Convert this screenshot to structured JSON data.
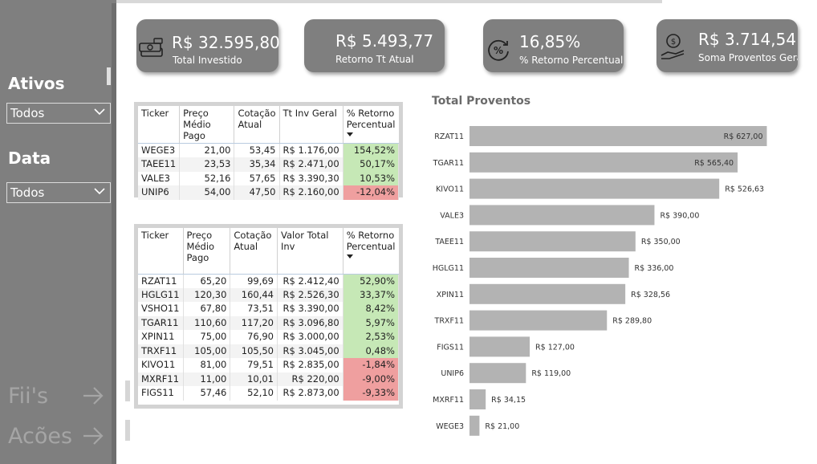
{
  "sidebar": {
    "filters": [
      {
        "label": "Ativos",
        "value": "Todos"
      },
      {
        "label": "Data",
        "value": "Todos"
      }
    ],
    "nav": [
      {
        "label": "Fii's"
      },
      {
        "label": "Acões"
      }
    ]
  },
  "kpis": [
    {
      "value": "R$ 32.595,80",
      "label": "Total Investido",
      "icon": "money-stack-icon"
    },
    {
      "value": "R$ 5.493,77",
      "label": "Retorno Tt Atual",
      "icon": ""
    },
    {
      "value": "16,85%",
      "label": "% Retorno Percentual",
      "icon": "percent-cycle-icon"
    },
    {
      "value": "R$ 3.714,54",
      "label": "Soma Proventos Geral",
      "icon": "hand-coin-icon"
    }
  ],
  "table_acoes": {
    "headers": [
      "Ticker",
      "Preço Médio Pago",
      "Cotação Atual",
      "Tt Inv Geral",
      "% Retorno Percentual"
    ],
    "rows": [
      [
        "WEGE3",
        "21,00",
        "53,45",
        "R$ 1.176,00",
        "154,52%"
      ],
      [
        "TAEE11",
        "23,53",
        "35,34",
        "R$ 2.471,00",
        "50,17%"
      ],
      [
        "VALE3",
        "52,16",
        "57,65",
        "R$ 3.390,30",
        "10,53%"
      ],
      [
        "UNIP6",
        "54,00",
        "47,50",
        "R$ 2.160,00",
        "-12,04%"
      ]
    ]
  },
  "table_fiis": {
    "headers": [
      "Ticker",
      "Preço Médio Pago",
      "Cotação Atual",
      "Valor Total Inv",
      "% Retorno Percentual"
    ],
    "rows": [
      [
        "RZAT11",
        "65,20",
        "99,69",
        "R$ 2.412,40",
        "52,90%"
      ],
      [
        "HGLG11",
        "120,30",
        "160,44",
        "R$ 2.526,30",
        "33,37%"
      ],
      [
        "VSHO11",
        "67,80",
        "73,51",
        "R$ 3.390,00",
        "8,42%"
      ],
      [
        "TGAR11",
        "110,60",
        "117,20",
        "R$ 3.096,80",
        "5,97%"
      ],
      [
        "XPIN11",
        "75,00",
        "76,90",
        "R$ 3.000,00",
        "2,53%"
      ],
      [
        "TRXF11",
        "105,00",
        "105,50",
        "R$ 3.045,00",
        "0,48%"
      ],
      [
        "KIVO11",
        "81,00",
        "79,51",
        "R$ 2.835,00",
        "-1,84%"
      ],
      [
        "MXRF11",
        "11,00",
        "10,01",
        "R$ 220,00",
        "-9,00%"
      ],
      [
        "FIGS11",
        "57,46",
        "52,10",
        "R$ 2.873,00",
        "-9,33%"
      ]
    ]
  },
  "colors": {
    "positive": "#c6e8b6",
    "negative": "#ef9f9f",
    "bar": "#b3b3b3",
    "panel": "#7f7f7f"
  },
  "chart_data": {
    "type": "bar",
    "orientation": "horizontal",
    "title": "Total Proventos",
    "categories": [
      "RZAT11",
      "TGAR11",
      "KIVO11",
      "VALE3",
      "TAEE11",
      "HGLG11",
      "XPIN11",
      "TRXF11",
      "FIGS11",
      "UNIP6",
      "MXRF11",
      "WEGE3"
    ],
    "values": [
      627.0,
      565.4,
      526.63,
      390.0,
      350.0,
      336.0,
      328.56,
      289.8,
      127.0,
      119.0,
      34.15,
      21.0
    ],
    "data_labels": [
      "R$ 627,00",
      "R$ 565,40",
      "R$ 526,63",
      "R$ 390,00",
      "R$ 350,00",
      "R$ 336,00",
      "R$ 328,56",
      "R$ 289,80",
      "R$ 127,00",
      "R$ 119,00",
      "R$ 34,15",
      "R$ 21,00"
    ],
    "xlim": [
      0,
      660
    ],
    "grid": false,
    "legend": "none"
  }
}
